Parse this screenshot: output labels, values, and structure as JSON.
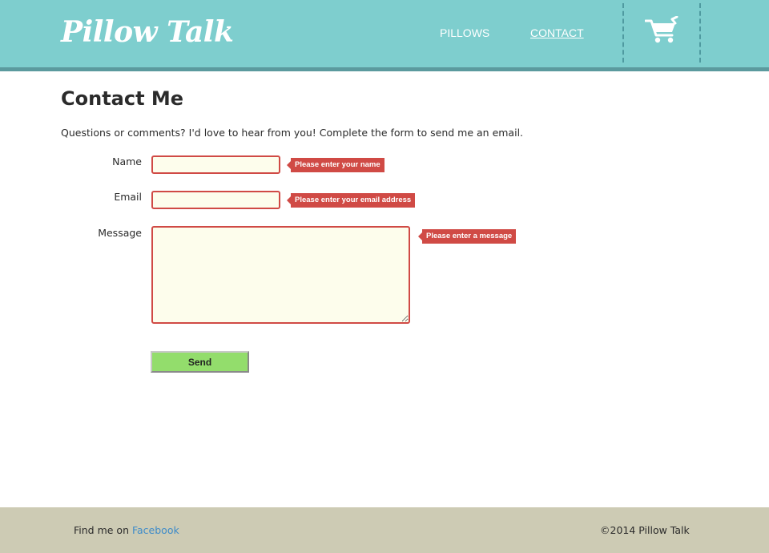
{
  "header": {
    "logo": "Pillow Talk",
    "nav": {
      "pillows": "PILLOWS",
      "contact": "CONTACT"
    },
    "cart_icon": "shopping-cart-icon",
    "background_color": "#7ecece",
    "accent_color": "#5b9a9e"
  },
  "main": {
    "title": "Contact Me",
    "intro": "Questions or comments? I'd love to hear from you! Complete the form to send me an email.",
    "form": {
      "name_label": "Name",
      "name_value": "",
      "email_label": "Email",
      "email_value": "",
      "message_label": "Message",
      "message_value": "",
      "errors": {
        "name": "Please enter your name",
        "email": "Please enter your email address",
        "message": "Please enter a message"
      },
      "send_label": "Send",
      "error_color": "#d04a45",
      "send_color": "#93dd6c"
    }
  },
  "footer": {
    "find_me_prefix": "Find me on ",
    "facebook_link": "Facebook",
    "copyright": "©2014 Pillow Talk",
    "background_color": "#cdcbb4"
  }
}
